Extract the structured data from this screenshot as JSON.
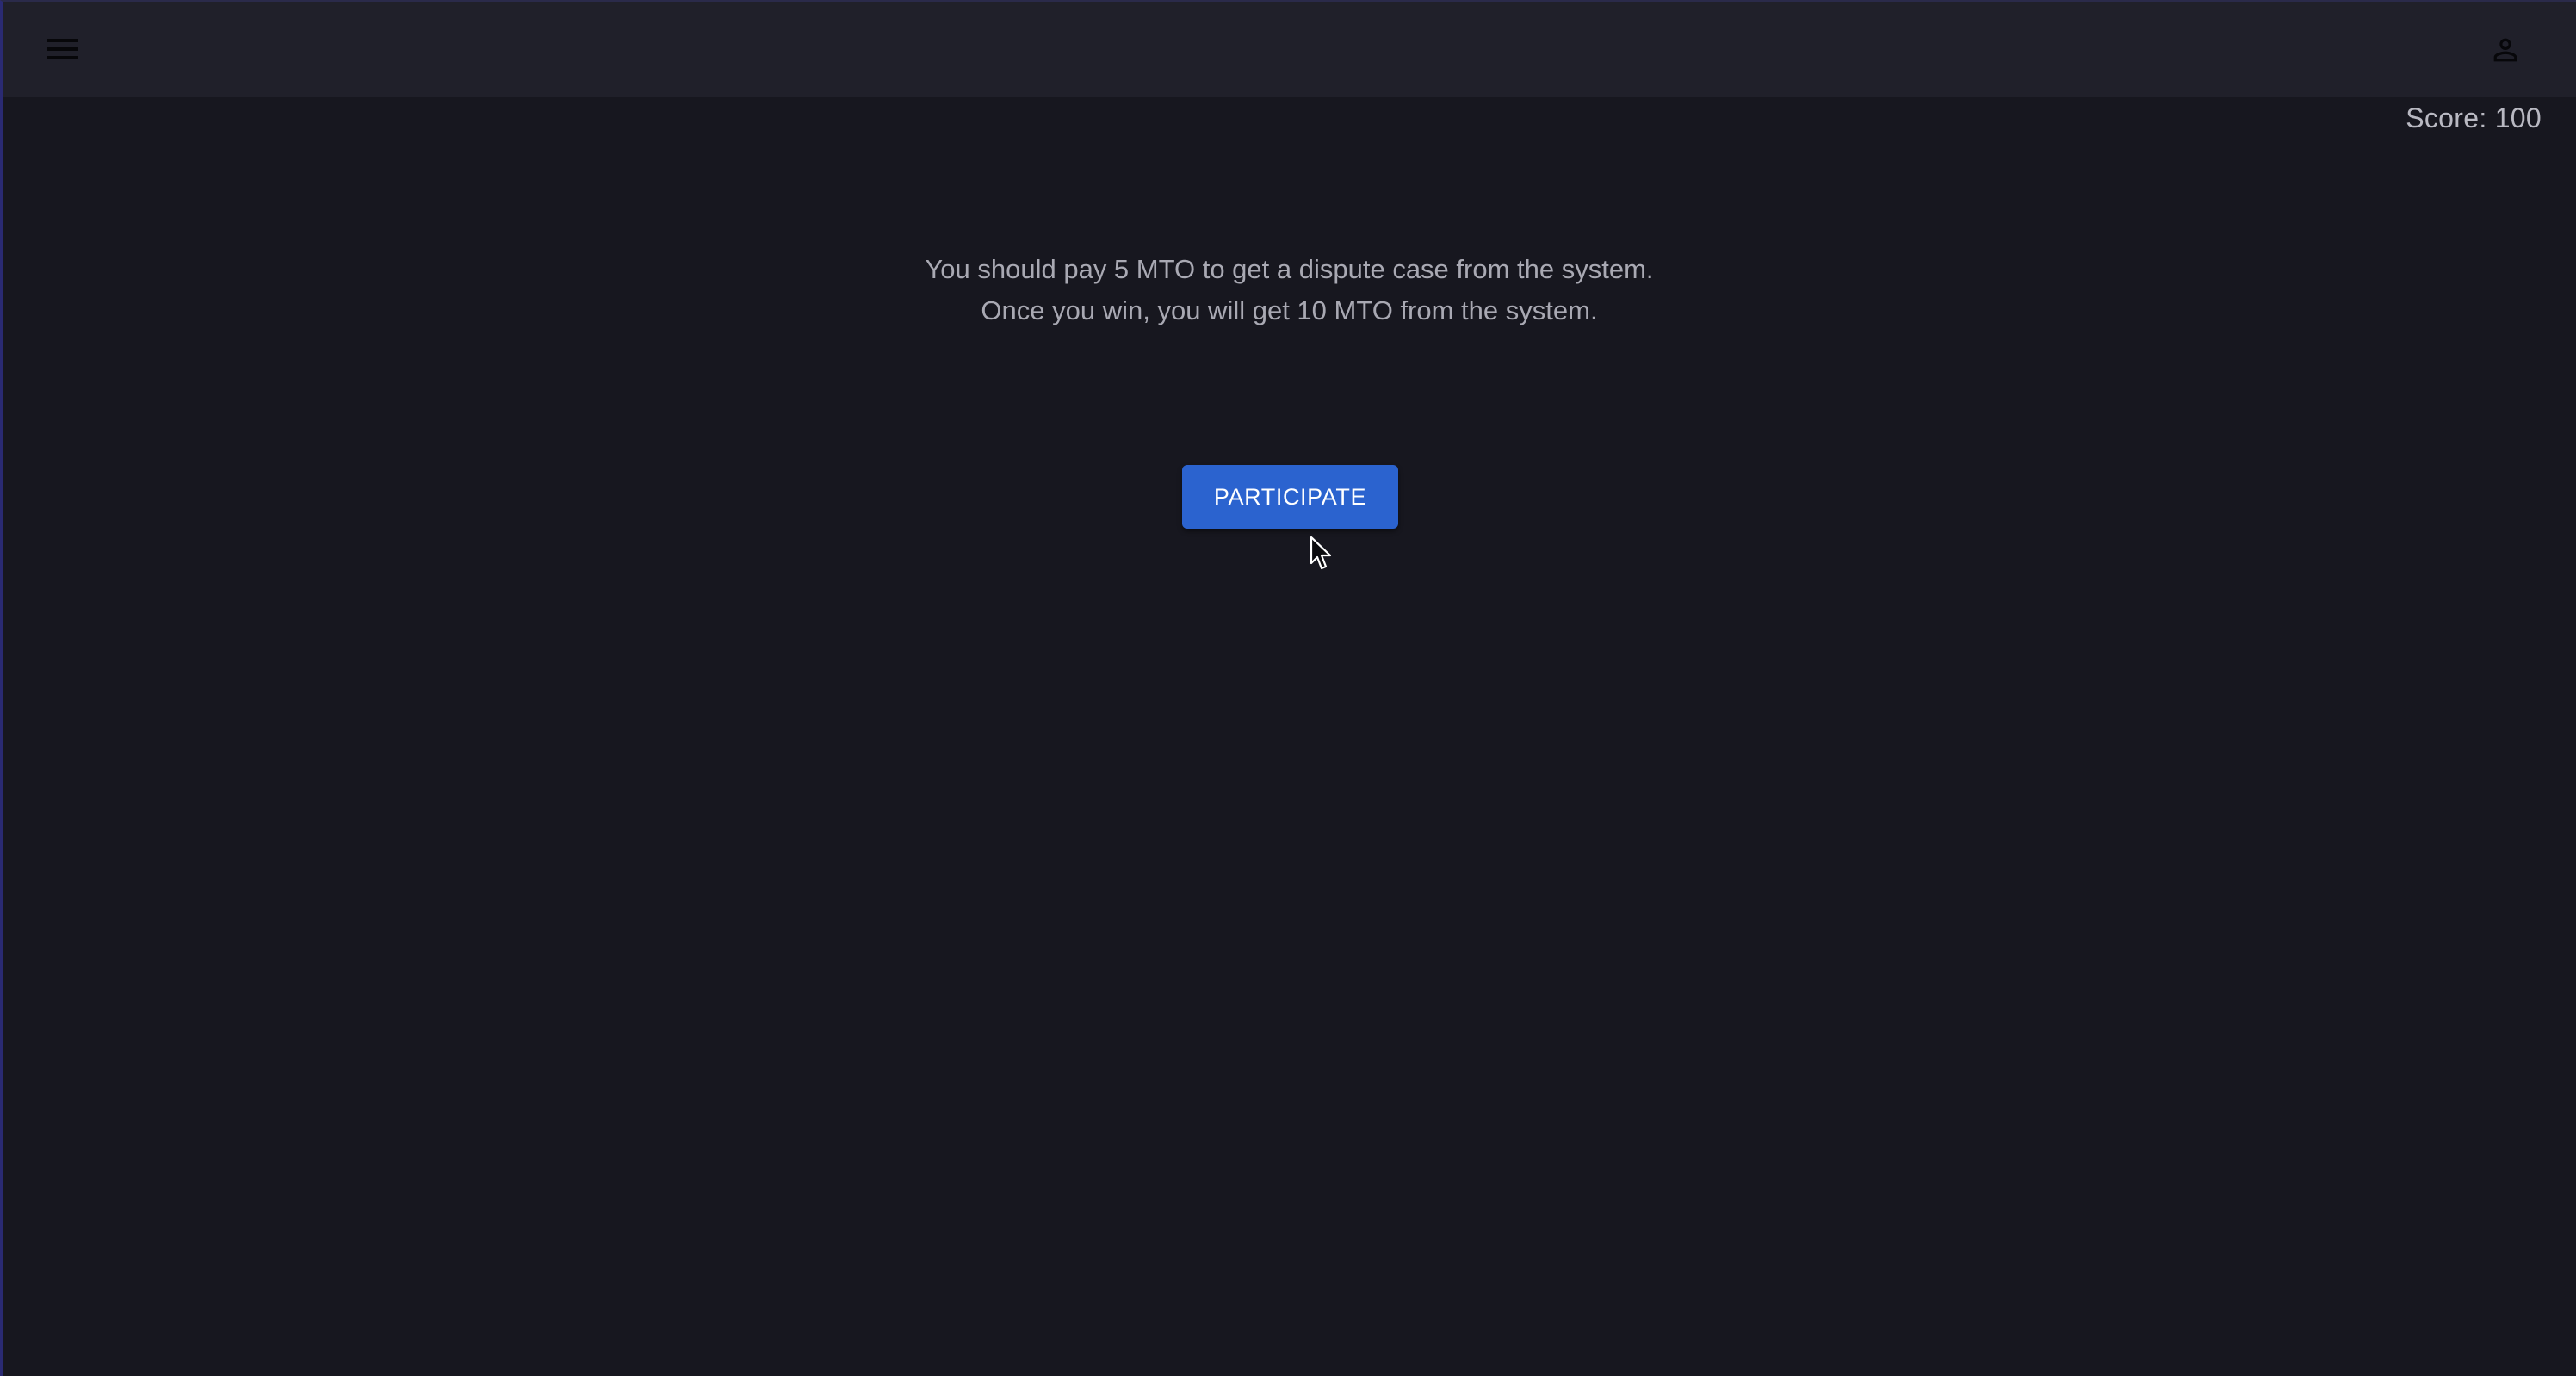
{
  "header": {
    "menu_icon": "hamburger-menu-icon",
    "account_icon": "person-outline-icon",
    "background_color": "#20202a"
  },
  "score": {
    "text": "Score: 100"
  },
  "info": {
    "line1": "You should pay 5 MTO to get a dispute case from the system.",
    "line2": "Once you win, you will get 10 MTO from the system."
  },
  "participate": {
    "label": "PARTICIPATE",
    "color": "#2b63cf"
  },
  "cursor": {
    "icon": "mouse-pointer-icon"
  },
  "colors": {
    "background": "#17171f",
    "text_muted": "#a9a9b3"
  }
}
